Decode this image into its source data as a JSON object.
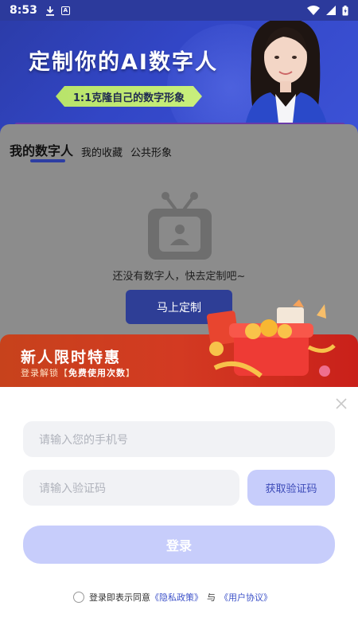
{
  "status_bar": {
    "time": "8:53"
  },
  "banner": {
    "title": "定制你的AI数字人",
    "tag": "1:1克隆自己的数字形象"
  },
  "tabs": [
    {
      "label": "我的数字人",
      "active": true
    },
    {
      "label": "我的收藏",
      "active": false
    },
    {
      "label": "公共形象",
      "active": false
    }
  ],
  "empty_state": {
    "text": "还没有数字人，快去定制吧~",
    "button": "马上定制"
  },
  "promo": {
    "title": "新人限时特惠",
    "subtitle_prefix": "登录解锁【",
    "subtitle_highlight": "免费使用次数",
    "subtitle_suffix": "】"
  },
  "login": {
    "phone_placeholder": "请输入您的手机号",
    "code_placeholder": "请输入验证码",
    "get_code_label": "获取验证码",
    "login_label": "登录",
    "agreement_prefix": "登录即表示同意",
    "privacy_link": "《隐私政策》",
    "and": "与",
    "terms_link": "《用户协议》"
  },
  "colors": {
    "banner_blue": "#3246c6",
    "primary_disabled": "#c7cdfb",
    "link": "#3d52c9",
    "promo_red": "#d33a22"
  }
}
